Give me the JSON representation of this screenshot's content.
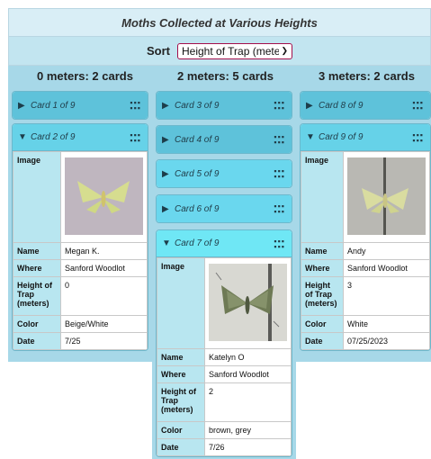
{
  "header": {
    "title": "Moths Collected at Various Heights"
  },
  "sort": {
    "label": "Sort",
    "selected": "Height of Trap (meters)"
  },
  "columns": [
    {
      "heading": "0 meters: 2 cards",
      "cards": [
        {
          "title": "Card 1 of 9",
          "expanded": false
        },
        {
          "title": "Card 2 of 9",
          "expanded": true,
          "fields": {
            "image_label": "Image",
            "name_label": "Name",
            "name": "Megan K.",
            "where_label": "Where",
            "where": "Sanford Woodlot",
            "height_label": "Height of Trap (meters)",
            "height": "0",
            "color_label": "Color",
            "color": "Beige/White",
            "date_label": "Date",
            "date": "7/25"
          }
        }
      ]
    },
    {
      "heading": "2 meters: 5 cards",
      "cards": [
        {
          "title": "Card 3 of 9",
          "expanded": false
        },
        {
          "title": "Card 4 of 9",
          "expanded": false
        },
        {
          "title": "Card 5 of 9",
          "expanded": false
        },
        {
          "title": "Card 6 of 9",
          "expanded": false
        },
        {
          "title": "Card 7 of 9",
          "expanded": true,
          "fields": {
            "image_label": "Image",
            "name_label": "Name",
            "name": "Katelyn O",
            "where_label": "Where",
            "where": "Sanford Woodlot",
            "height_label": "Height of Trap (meters)",
            "height": "2",
            "color_label": "Color",
            "color": "brown, grey",
            "date_label": "Date",
            "date": "7/26"
          }
        }
      ]
    },
    {
      "heading": "3 meters: 2 cards",
      "cards": [
        {
          "title": "Card 8 of 9",
          "expanded": false
        },
        {
          "title": "Card 9 of 9",
          "expanded": true,
          "fields": {
            "image_label": "Image",
            "name_label": "Name",
            "name": "Andy",
            "where_label": "Where",
            "where": "Sanford Woodlot",
            "height_label": "Height of Trap (meters)",
            "height": "3",
            "color_label": "Color",
            "color": "White",
            "date_label": "Date",
            "date": "07/25/2023"
          }
        }
      ]
    }
  ]
}
